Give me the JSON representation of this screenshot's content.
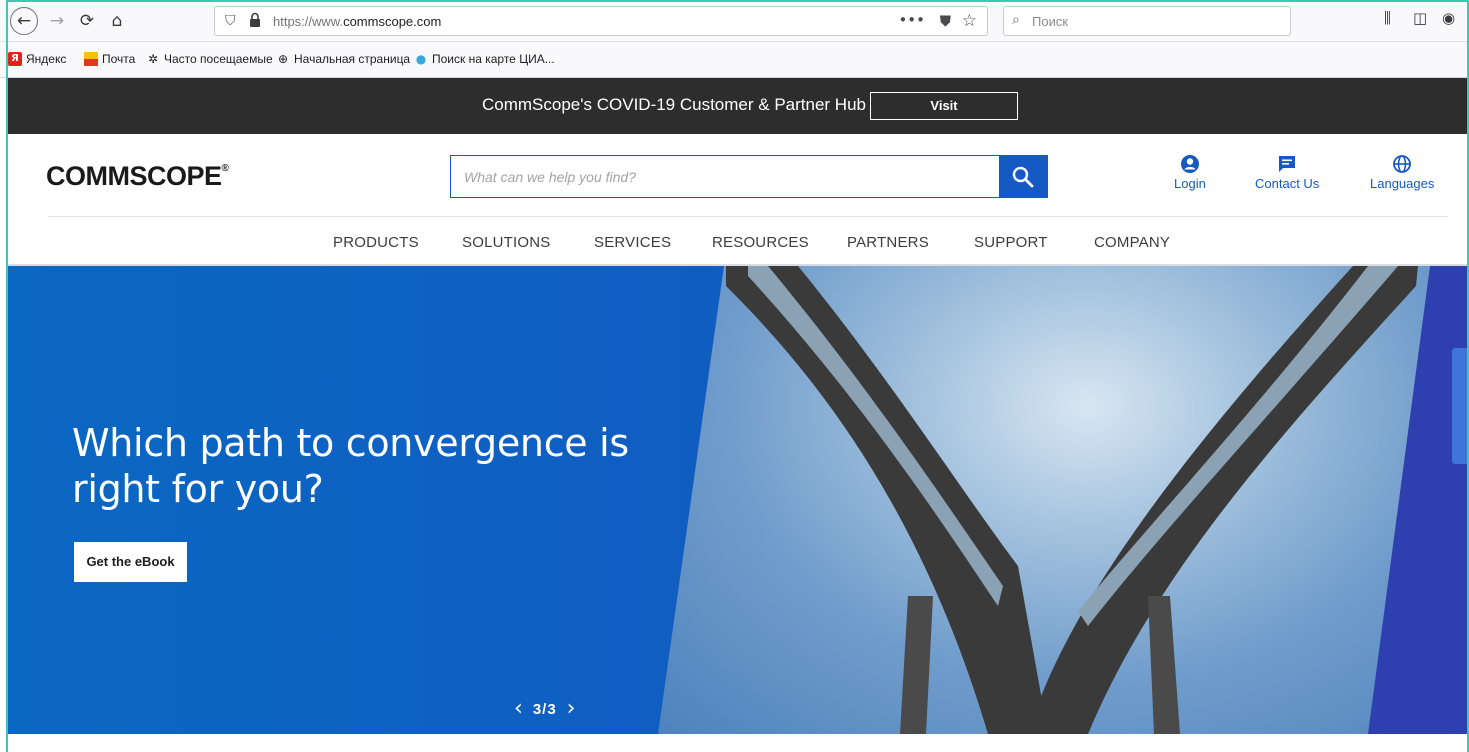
{
  "browser": {
    "url_prefix": "https://www.",
    "url_domain": "commscope.com",
    "search_placeholder": "Поиск",
    "bookmarks": [
      "Яндекс",
      "Почта",
      "Часто посещаемые",
      "Начальная страница",
      "Поиск на карте ЦИА..."
    ]
  },
  "banner": {
    "text": "CommScope's COVID-19 Customer & Partner Hub",
    "button": "Visit"
  },
  "header": {
    "logo": "COMMSCOPE",
    "logo_mark": "®",
    "search_placeholder": "What can we help you find?",
    "links": {
      "login": "Login",
      "contact": "Contact Us",
      "languages": "Languages"
    }
  },
  "nav": [
    "PRODUCTS",
    "SOLUTIONS",
    "SERVICES",
    "RESOURCES",
    "PARTNERS",
    "SUPPORT",
    "COMPANY"
  ],
  "hero": {
    "headline": "Which path to convergence is right for you?",
    "cta": "Get the eBook",
    "pager": "3/3"
  },
  "colors": {
    "brand_blue": "#1559c5",
    "banner_bg": "#2d2d2d",
    "hero_blue": "#0f5fc3"
  }
}
